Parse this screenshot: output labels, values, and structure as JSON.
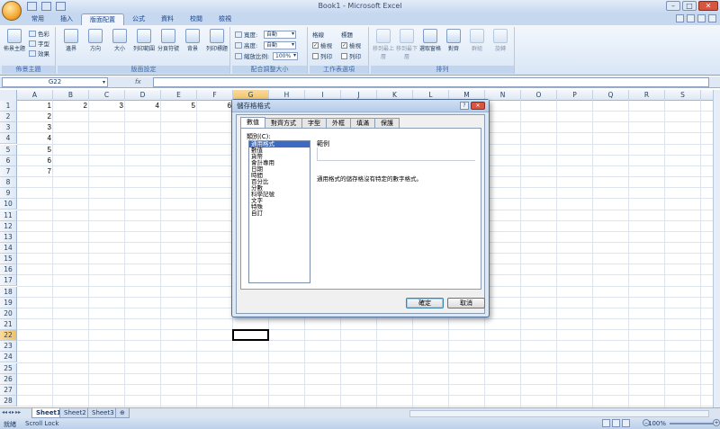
{
  "window": {
    "title": "Book1 - Microsoft Excel"
  },
  "ribbon_tabs": [
    "常用",
    "插入",
    "版面配置",
    "公式",
    "資料",
    "校閱",
    "檢視"
  ],
  "active_tab_index": 2,
  "ribbon": {
    "theme_group": {
      "label": "佈景主題",
      "theme_button": "佈景主題",
      "colors": "色彩",
      "fonts": "字型",
      "effects": "效果"
    },
    "page_setup_group": {
      "label": "版面設定",
      "buttons": [
        "邊界",
        "方向",
        "大小",
        "列印範圍",
        "分頁符號",
        "背景",
        "列印標題"
      ]
    },
    "scale_group": {
      "label": "配合調整大小",
      "width_label": "寬度:",
      "width_value": "自動",
      "height_label": "高度:",
      "height_value": "自動",
      "scale_label": "縮放比例:",
      "scale_value": "100%"
    },
    "sheet_options_group": {
      "label": "工作表選項",
      "gridlines": "格線",
      "headings": "標題",
      "view": "檢視",
      "print": "列印"
    },
    "arrange_group": {
      "label": "排列",
      "buttons": [
        "移到最上層",
        "移到最下層",
        "選取窗格",
        "對齊",
        "群組",
        "旋轉"
      ]
    }
  },
  "formula_bar": {
    "name_box": "G22",
    "fx": "fx",
    "value": ""
  },
  "columns": [
    "A",
    "B",
    "C",
    "D",
    "E",
    "F",
    "G",
    "H",
    "I",
    "J",
    "K",
    "L",
    "M",
    "N",
    "O",
    "P",
    "Q",
    "R",
    "S"
  ],
  "selected_column": "G",
  "rows": [
    "1",
    "2",
    "3",
    "4",
    "5",
    "6",
    "7",
    "8",
    "9",
    "10",
    "11",
    "12",
    "13",
    "14",
    "15",
    "16",
    "17",
    "18",
    "19",
    "20",
    "21",
    "22",
    "23",
    "24",
    "25",
    "26",
    "27",
    "28"
  ],
  "selected_row": "22",
  "cells": {
    "A1": "1",
    "B1": "2",
    "C1": "3",
    "D1": "4",
    "E1": "5",
    "F1": "6",
    "A2": "2",
    "A3": "3",
    "A4": "4",
    "A5": "5",
    "A6": "6",
    "A7": "7"
  },
  "sheet_tabs": [
    "Sheet1",
    "Sheet2",
    "Sheet3"
  ],
  "active_sheet": "Sheet1",
  "status": {
    "ready": "就緒",
    "scroll_lock": "Scroll Lock",
    "zoom": "100%"
  },
  "dialog": {
    "title": "儲存格格式",
    "tabs": [
      "數值",
      "對齊方式",
      "字型",
      "外框",
      "填滿",
      "保護"
    ],
    "active_tab": "數值",
    "category_label": "類別(C):",
    "categories": [
      "通用格式",
      "數值",
      "貨幣",
      "會計專用",
      "日期",
      "時間",
      "百分比",
      "分數",
      "科學記號",
      "文字",
      "特殊",
      "自訂"
    ],
    "selected_category": "通用格式",
    "sample_label": "範例",
    "description": "通用格式的儲存格沒有特定的數字格式。",
    "ok": "確定",
    "cancel": "取消"
  }
}
